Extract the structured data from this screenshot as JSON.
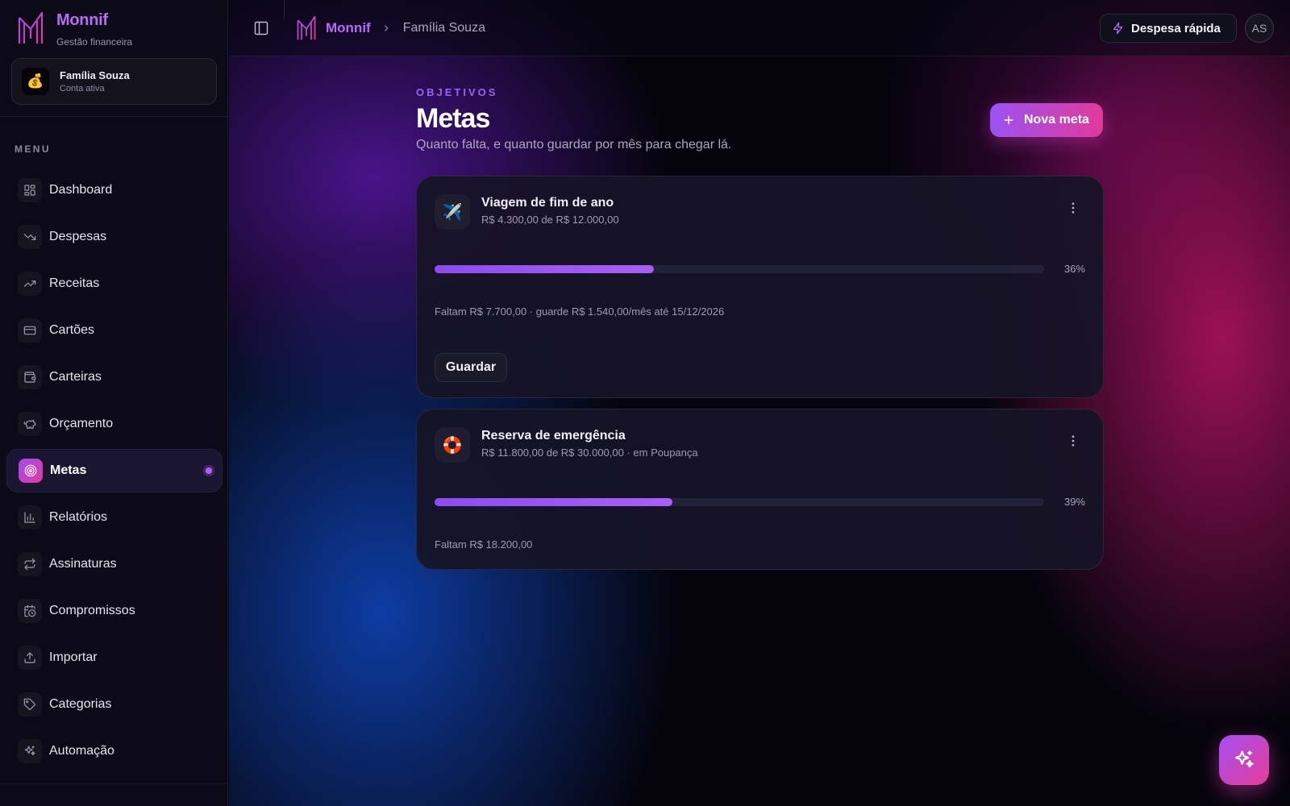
{
  "brand": {
    "name": "Monnif",
    "tagline": "Gestão financeira"
  },
  "account": {
    "icon": "💰",
    "name": "Família Souza",
    "status": "Conta ativa"
  },
  "sidebar": {
    "menu_label": "MENU",
    "items": [
      {
        "label": "Dashboard",
        "icon": "dashboard-icon"
      },
      {
        "label": "Despesas",
        "icon": "trending-down-icon"
      },
      {
        "label": "Receitas",
        "icon": "trending-up-icon"
      },
      {
        "label": "Cartões",
        "icon": "credit-card-icon"
      },
      {
        "label": "Carteiras",
        "icon": "wallet-icon"
      },
      {
        "label": "Orçamento",
        "icon": "piggy-bank-icon"
      },
      {
        "label": "Metas",
        "icon": "target-icon",
        "active": true
      },
      {
        "label": "Relatórios",
        "icon": "bar-chart-icon"
      },
      {
        "label": "Assinaturas",
        "icon": "repeat-icon"
      },
      {
        "label": "Compromissos",
        "icon": "calendar-clock-icon"
      },
      {
        "label": "Importar",
        "icon": "upload-icon"
      },
      {
        "label": "Categorias",
        "icon": "tag-icon"
      },
      {
        "label": "Automação",
        "icon": "sparkles-icon"
      }
    ]
  },
  "topbar": {
    "breadcrumb_brand": "Monnif",
    "breadcrumb_current": "Família Souza",
    "quick_expense_label": "Despesa rápida",
    "avatar_initials": "AS"
  },
  "page": {
    "eyebrow": "OBJETIVOS",
    "title": "Metas",
    "subtitle": "Quanto falta, e quanto guardar por mês para chegar lá.",
    "new_goal_label": "Nova meta"
  },
  "goals": [
    {
      "icon": "✈️",
      "name": "Viagem de fim de ano",
      "amount": "R$ 4.300,00 de R$ 12.000,00",
      "progress": 0.36,
      "percent_label": "36%",
      "note": "Faltam R$ 7.700,00 · guarde R$ 1.540,00/mês até 15/12/2026",
      "action_label": "Guardar"
    },
    {
      "icon": "🛟",
      "name": "Reserva de emergência",
      "amount": "R$ 11.800,00 de R$ 30.000,00 · em Poupança",
      "progress": 0.39,
      "percent_label": "39%",
      "note": "Faltam R$ 18.200,00"
    }
  ],
  "colors": {
    "accent_purple": "#9a52f2",
    "accent_pink": "#e23a9c",
    "progress": "#8c4cf0"
  }
}
